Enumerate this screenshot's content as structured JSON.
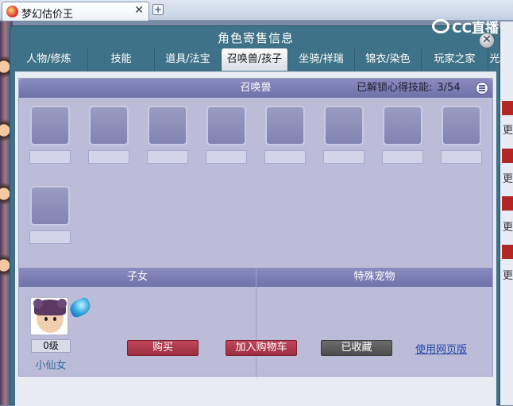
{
  "browser": {
    "tab_title": "梦幻估价王",
    "close_glyph": "✕",
    "new_tab_glyph": "+"
  },
  "background_right": {
    "text_chars": [
      "更",
      "更",
      "更",
      "更",
      "更"
    ]
  },
  "dialog": {
    "title": "角色寄售信息",
    "logo_text": "CC直播",
    "close_glyph": "✕",
    "tabs": [
      {
        "label": "人物/修炼"
      },
      {
        "label": "技能"
      },
      {
        "label": "道具/法宝"
      },
      {
        "label": "召唤兽/孩子"
      },
      {
        "label": "坐骑/祥瑞"
      },
      {
        "label": "锦衣/染色"
      },
      {
        "label": "玩家之家"
      },
      {
        "label": "光"
      }
    ],
    "active_tab": "召唤兽/孩子"
  },
  "summon": {
    "header": "召唤兽",
    "skills_label": "已解锁心得技能:",
    "skills_value": "3/54"
  },
  "children": {
    "header": "子女",
    "items": [
      {
        "level": "0级",
        "name": "小仙女"
      }
    ]
  },
  "pets": {
    "header": "特殊宠物"
  },
  "actions": {
    "buy": "购买",
    "add_cart": "加入购物车",
    "collected": "已收藏",
    "web_version": "使用网页版"
  },
  "colors": {
    "dialog_bg": "#3f7288",
    "panel_header": "#7577ad",
    "button_red": "#a83346",
    "button_gray": "#555555",
    "link": "#2244aa"
  }
}
